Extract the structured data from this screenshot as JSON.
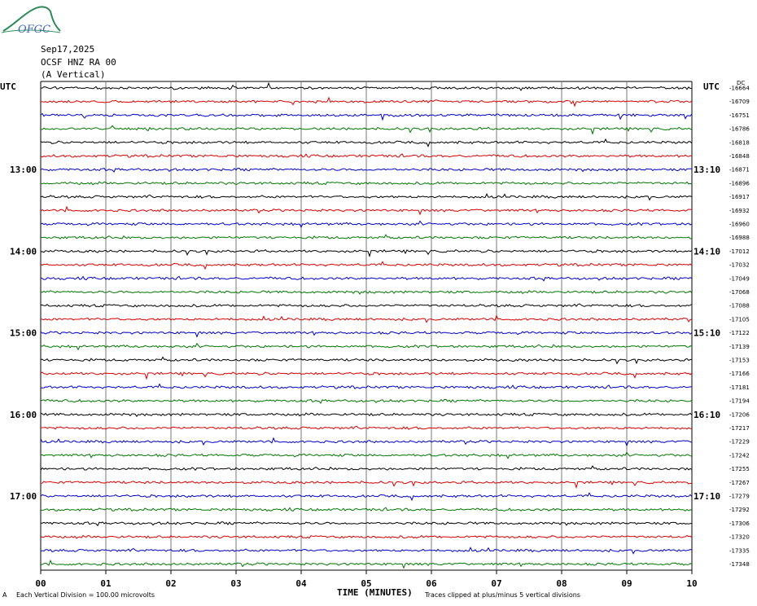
{
  "logo": {
    "text": "OFGC",
    "leaf_color": "#2e8b57",
    "text_color": "#4169aa"
  },
  "header": {
    "date": "Sep17,2025",
    "station": "OCSF HNZ RA 00",
    "component": "(A Vertical)"
  },
  "utc_left": "UTC",
  "utc_right": "UTC",
  "dc_label": "DC",
  "x_axis_title": "TIME (MINUTES)",
  "footer_left": "Each Vertical Division =  100.00 microvolts",
  "footer_right": "Traces clipped at plus/minus 5 vertical divisions",
  "footer_mark": "A",
  "colors": {
    "trace_cycle": [
      "#000000",
      "#dd0000",
      "#0000cc",
      "#007700"
    ],
    "grid": "#777777"
  },
  "chart_data": {
    "type": "line",
    "title": "",
    "xlabel": "TIME (MINUTES)",
    "x_ticks": [
      "00",
      "01",
      "02",
      "03",
      "04",
      "05",
      "06",
      "07",
      "08",
      "09",
      "10"
    ],
    "xlim": [
      0,
      10
    ],
    "rows": 36,
    "left_time_labels": [
      {
        "row": 6,
        "label": "13:00"
      },
      {
        "row": 12,
        "label": "14:00"
      },
      {
        "row": 18,
        "label": "15:00"
      },
      {
        "row": 24,
        "label": "16:00"
      },
      {
        "row": 30,
        "label": "17:00"
      }
    ],
    "right_time_labels": [
      {
        "row": 6,
        "label": "13:10"
      },
      {
        "row": 12,
        "label": "14:10"
      },
      {
        "row": 18,
        "label": "15:10"
      },
      {
        "row": 24,
        "label": "16:10"
      },
      {
        "row": 30,
        "label": "17:10"
      }
    ],
    "dc_offsets": [
      "-16664",
      "-16709",
      "-16751",
      "-16786",
      "-16818",
      "-16848",
      "-16871",
      "-16896",
      "-16917",
      "-16932",
      "-16960",
      "-16988",
      "-17012",
      "-17032",
      "-17049",
      "-17068",
      "-17088",
      "-17105",
      "-17122",
      "-17139",
      "-17153",
      "-17166",
      "-17181",
      "-17194",
      "-17206",
      "-17217",
      "-17229",
      "-17242",
      "-17255",
      "-17267",
      "-17279",
      "-17292",
      "-17306",
      "-17320",
      "-17335",
      "-17348"
    ]
  }
}
